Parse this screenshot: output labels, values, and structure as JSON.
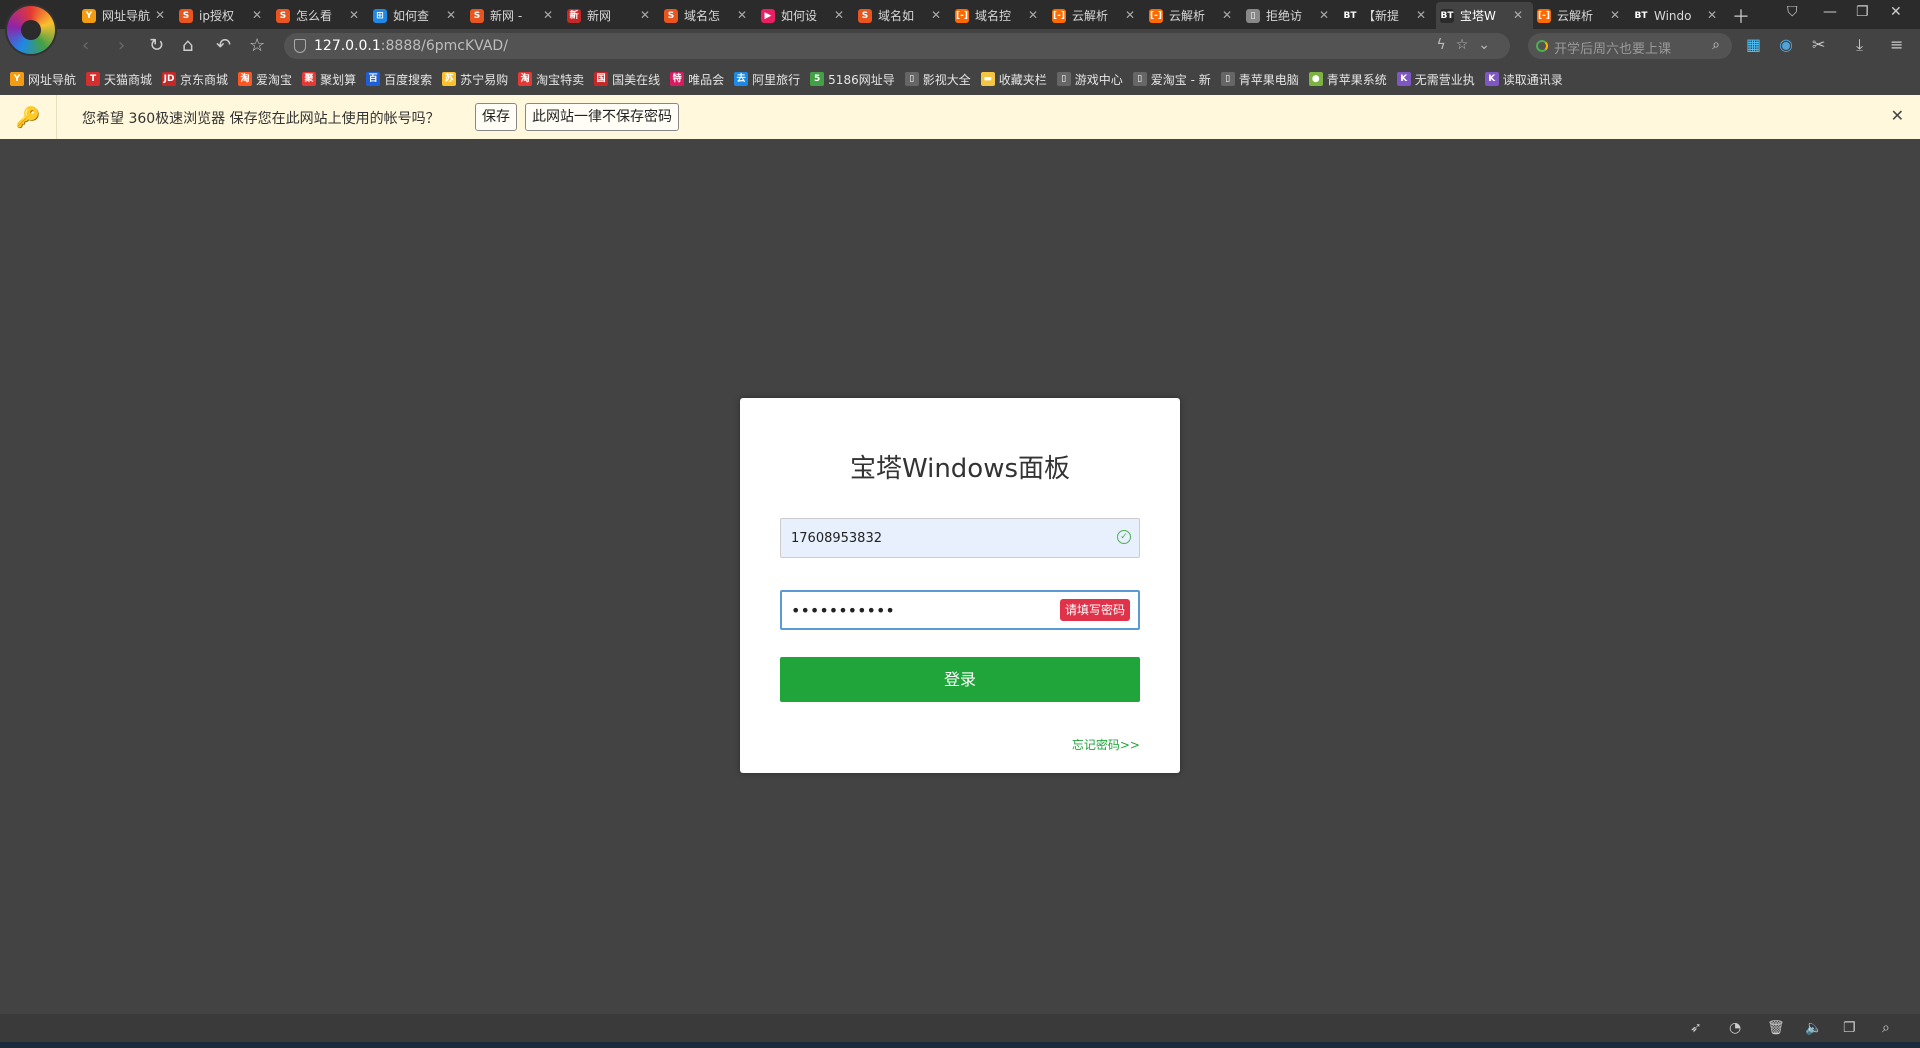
{
  "tabs": [
    {
      "label": "网址导航",
      "color": "#f39c12",
      "icon": "Y"
    },
    {
      "label": "ip授权",
      "color": "#e8551f",
      "icon": "S"
    },
    {
      "label": "怎么看",
      "color": "#e8551f",
      "icon": "S"
    },
    {
      "label": "如何查",
      "color": "#1e88e5",
      "icon": "⊞"
    },
    {
      "label": "新网 -",
      "color": "#e8551f",
      "icon": "S"
    },
    {
      "label": "新网",
      "color": "#c62828",
      "icon": "新"
    },
    {
      "label": "域名怎",
      "color": "#e8551f",
      "icon": "S"
    },
    {
      "label": "如何设",
      "color": "#e91e63",
      "icon": "▶"
    },
    {
      "label": "域名如",
      "color": "#e8551f",
      "icon": "S"
    },
    {
      "label": "域名控",
      "color": "#ff6a00",
      "icon": "[-]"
    },
    {
      "label": "云解析",
      "color": "#ff6a00",
      "icon": "[-]"
    },
    {
      "label": "云解析",
      "color": "#ff6a00",
      "icon": "[-]"
    },
    {
      "label": "拒绝访",
      "color": "#888888",
      "icon": "▯"
    },
    {
      "label": "【新提",
      "color": "#2b2b2b",
      "icon": "BT"
    },
    {
      "label": "宝塔W",
      "color": "#2b2b2b",
      "icon": "BT",
      "active": true
    },
    {
      "label": "云解析",
      "color": "#ff6a00",
      "icon": "[-]"
    },
    {
      "label": "Windo",
      "color": "#2b2b2b",
      "icon": "BT"
    }
  ],
  "address": {
    "host": "127.0.0.1",
    "path": ":8888/6pmcKVAD/"
  },
  "search": {
    "placeholder": "开学后周六也要上课"
  },
  "bookmarks": [
    {
      "label": "网址导航",
      "color": "#f39c12",
      "icon": "Y"
    },
    {
      "label": "天猫商城",
      "color": "#d32f2f",
      "icon": "T"
    },
    {
      "label": "京东商城",
      "color": "#c62828",
      "icon": "JD"
    },
    {
      "label": "爱淘宝",
      "color": "#ff5722",
      "icon": "淘"
    },
    {
      "label": "聚划算",
      "color": "#e53935",
      "icon": "聚"
    },
    {
      "label": "百度搜索",
      "color": "#1e5fd8",
      "icon": "百"
    },
    {
      "label": "苏宁易购",
      "color": "#fbc02d",
      "icon": "苏"
    },
    {
      "label": "淘宝特卖",
      "color": "#e53935",
      "icon": "淘"
    },
    {
      "label": "国美在线",
      "color": "#c62828",
      "icon": "国"
    },
    {
      "label": "唯品会",
      "color": "#d81b60",
      "icon": "特"
    },
    {
      "label": "阿里旅行",
      "color": "#1e88e5",
      "icon": "去"
    },
    {
      "label": "5186网址导",
      "color": "#43a047",
      "icon": "5"
    },
    {
      "label": "影视大全",
      "color": "#666666",
      "icon": "▯"
    },
    {
      "label": "收藏夹栏",
      "color": "#f4c542",
      "icon": "▬"
    },
    {
      "label": "游戏中心",
      "color": "#666666",
      "icon": "▯"
    },
    {
      "label": "爱淘宝 - 新",
      "color": "#666666",
      "icon": "▯"
    },
    {
      "label": "青苹果电脑",
      "color": "#666666",
      "icon": "▯"
    },
    {
      "label": "青苹果系统",
      "color": "#7cb342",
      "icon": "●"
    },
    {
      "label": "无需营业执",
      "color": "#7e57c2",
      "icon": "K"
    },
    {
      "label": "读取通讯录",
      "color": "#7e57c2",
      "icon": "K"
    }
  ],
  "notice": {
    "text": "您希望 360极速浏览器 保存您在此网站上使用的帐号吗？",
    "save_label": "保存",
    "never_label": "此网站一律不保存密码",
    "close_glyph": "✕",
    "key_glyph": "🔑"
  },
  "login": {
    "title": "宝塔Windows面板",
    "username_value": "17608953832",
    "password_value": "•••••••••••",
    "password_error": "请填写密码",
    "submit_label": "登录",
    "forgot_label": "忘记密码>>"
  },
  "colors": {
    "accent": "#20a53a",
    "error": "#e0334a",
    "background": "#434343"
  }
}
